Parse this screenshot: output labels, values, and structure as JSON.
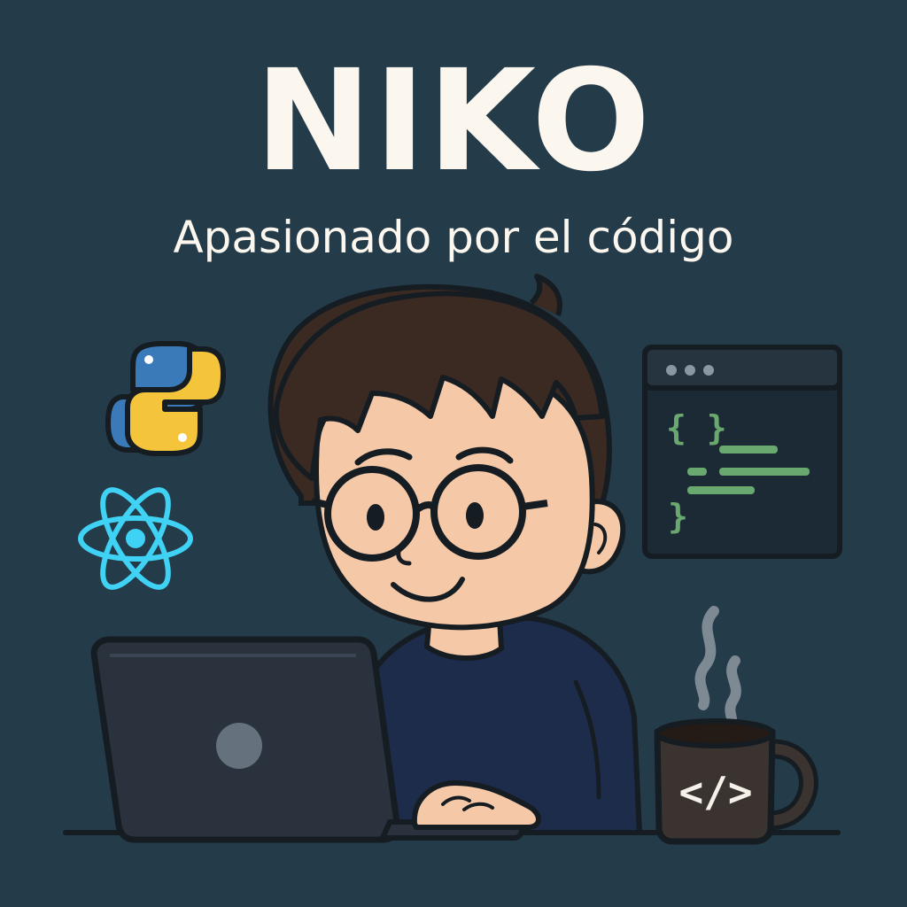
{
  "header": {
    "title": "NIKO",
    "subtitle": "Apasionado por el código"
  },
  "code_window": {
    "braces_open": "{ }",
    "brace_close": "}"
  },
  "mug": {
    "label": "</>"
  },
  "colors": {
    "background": "#243b4a",
    "title_text": "#fbf6ee",
    "outline": "#151c22",
    "hair": "#3b2a22",
    "skin": "#f5c9a8",
    "sweater": "#1e2c4c",
    "laptop": "#2a323e",
    "python_blue": "#3a7ab8",
    "python_yellow": "#f4c53b",
    "react_cyan": "#3fd2f4",
    "code_green": "#69a86e",
    "mug": "#3b3330"
  },
  "icons": [
    "python-logo-icon",
    "react-atom-icon",
    "code-window-icon",
    "coffee-mug-icon",
    "steam-icon"
  ]
}
